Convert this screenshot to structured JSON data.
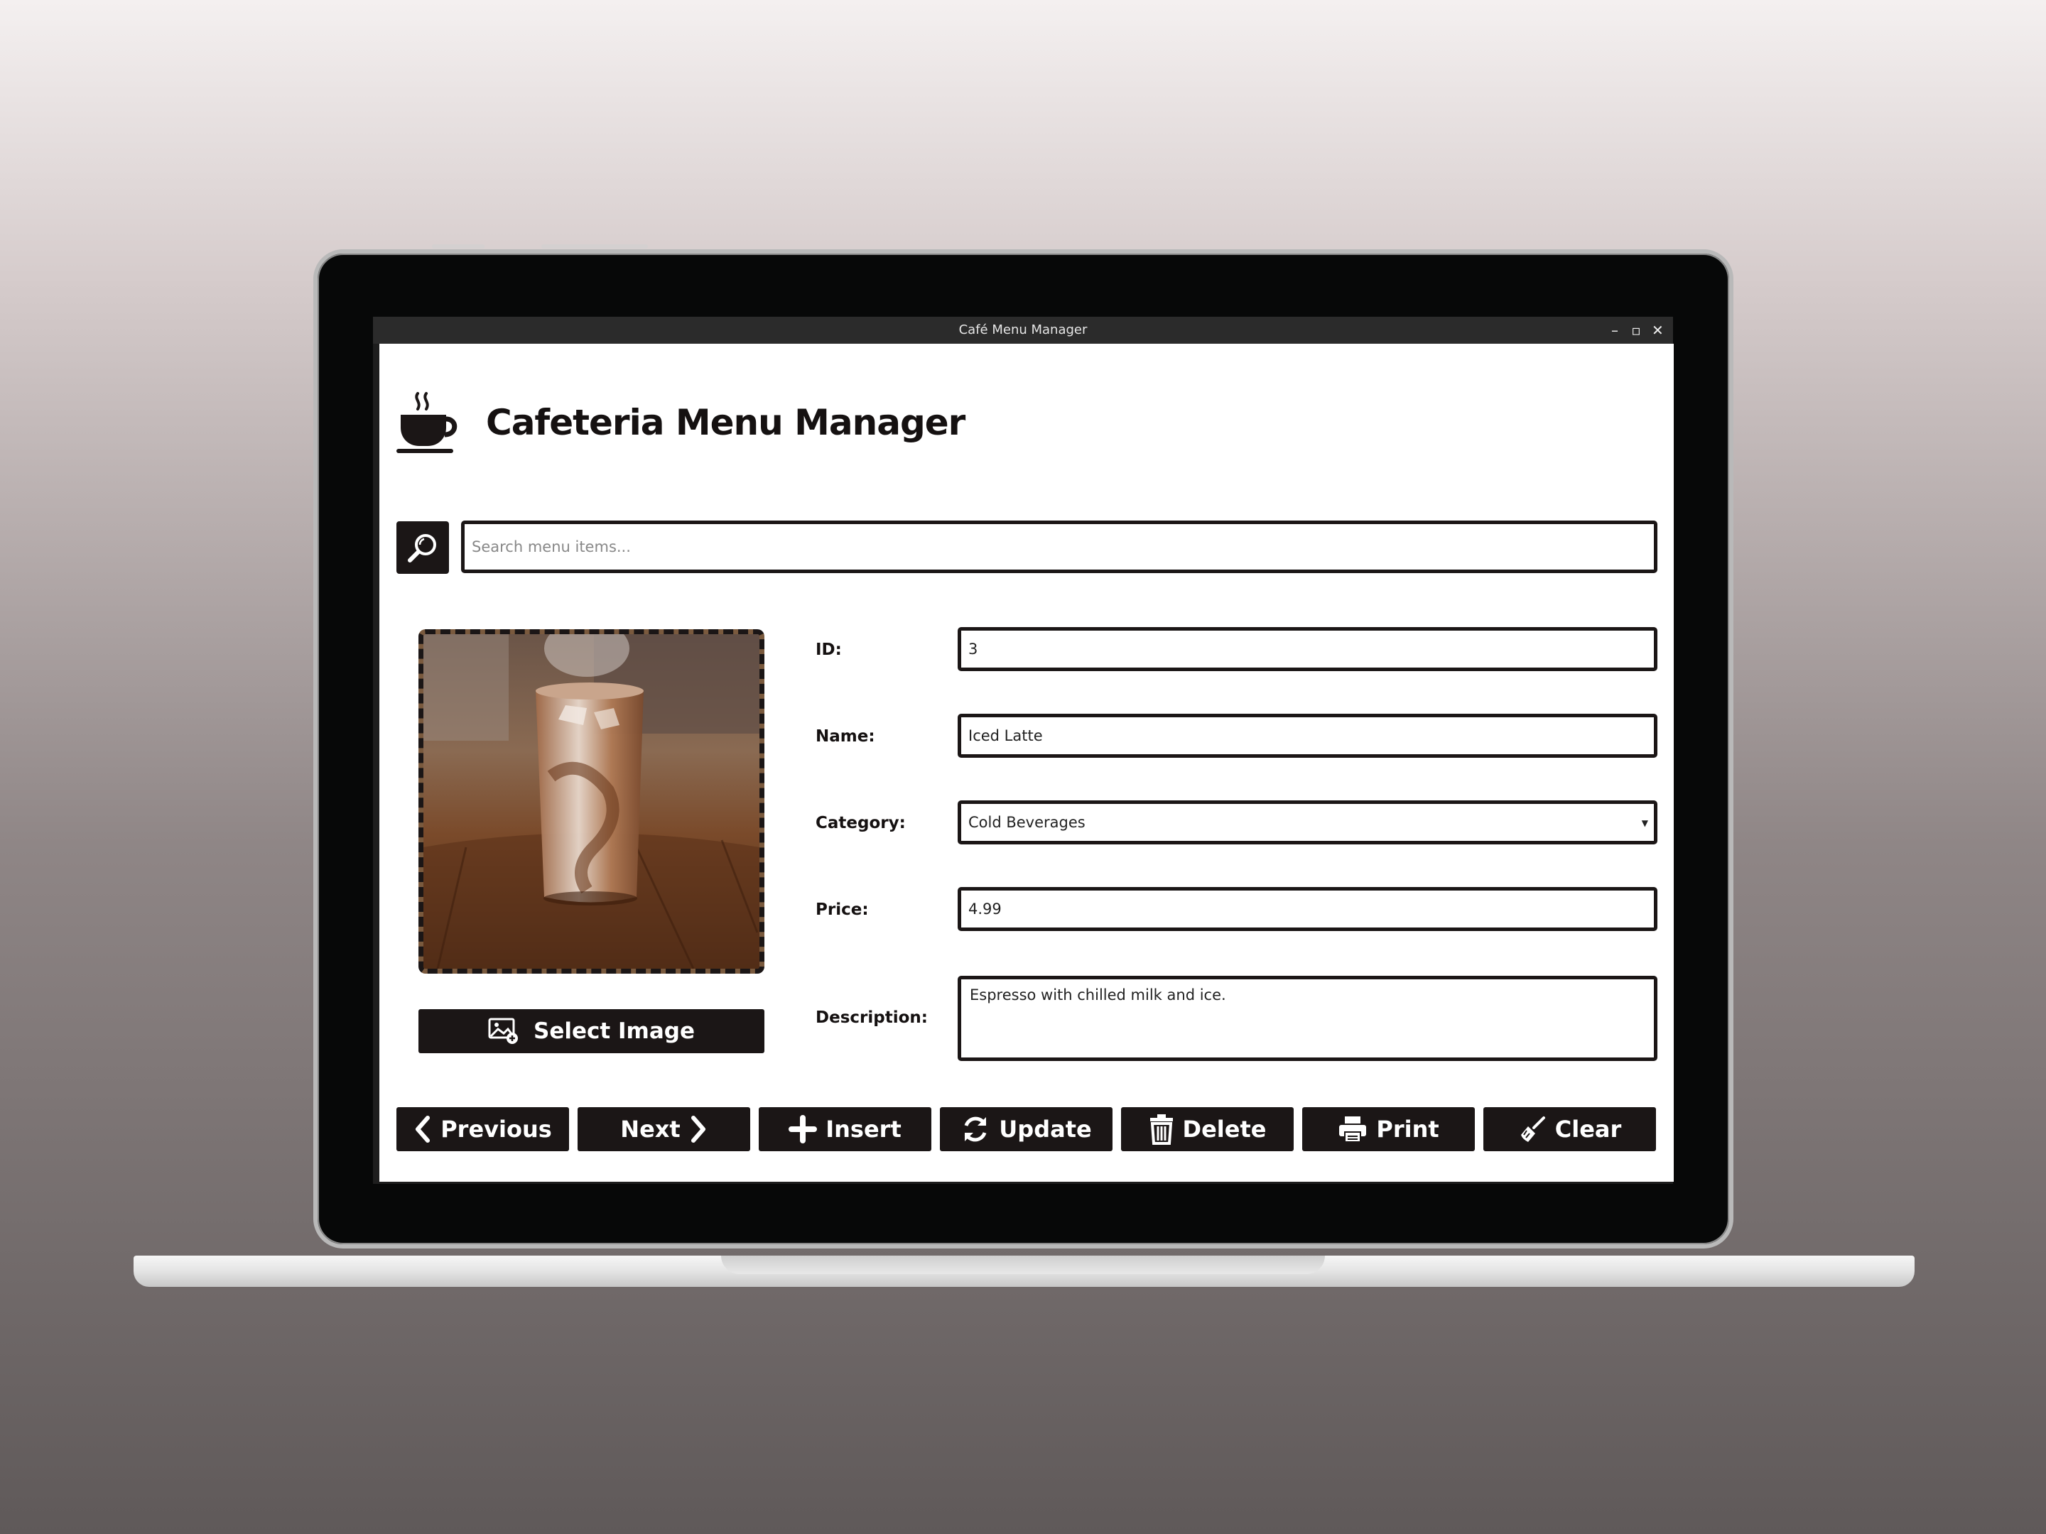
{
  "window": {
    "title": "Café Menu Manager",
    "controls": [
      "–",
      "▫",
      "✕"
    ]
  },
  "header": {
    "icon": "coffee-cup-icon",
    "title": "Cafeteria Menu Manager"
  },
  "search": {
    "icon": "search-icon",
    "placeholder": "Search menu items...",
    "value": ""
  },
  "image_panel": {
    "image": "iced-latte-photo",
    "select_button": {
      "icon": "image-add-icon",
      "label": "Select Image"
    }
  },
  "form": {
    "id": {
      "label": "ID:",
      "value": "3"
    },
    "name": {
      "label": "Name:",
      "value": "Iced Latte"
    },
    "category": {
      "label": "Category:",
      "value": "Cold Beverages"
    },
    "price": {
      "label": "Price:",
      "value": "4.99"
    },
    "description": {
      "label": "Description:",
      "value": "Espresso with chilled milk and ice."
    }
  },
  "actions": {
    "previous": {
      "icon": "chevron-left-icon",
      "label": "Previous"
    },
    "next": {
      "icon": "chevron-right-icon",
      "label": "Next"
    },
    "insert": {
      "icon": "plus-icon",
      "label": "Insert"
    },
    "update": {
      "icon": "refresh-icon",
      "label": "Update"
    },
    "delete": {
      "icon": "trash-icon",
      "label": "Delete"
    },
    "print": {
      "icon": "printer-icon",
      "label": "Print"
    },
    "clear": {
      "icon": "broom-icon",
      "label": "Clear"
    }
  },
  "colors": {
    "primary": "#1b1616",
    "background": "#ffffff",
    "titlebar": "#2b2b2b"
  }
}
